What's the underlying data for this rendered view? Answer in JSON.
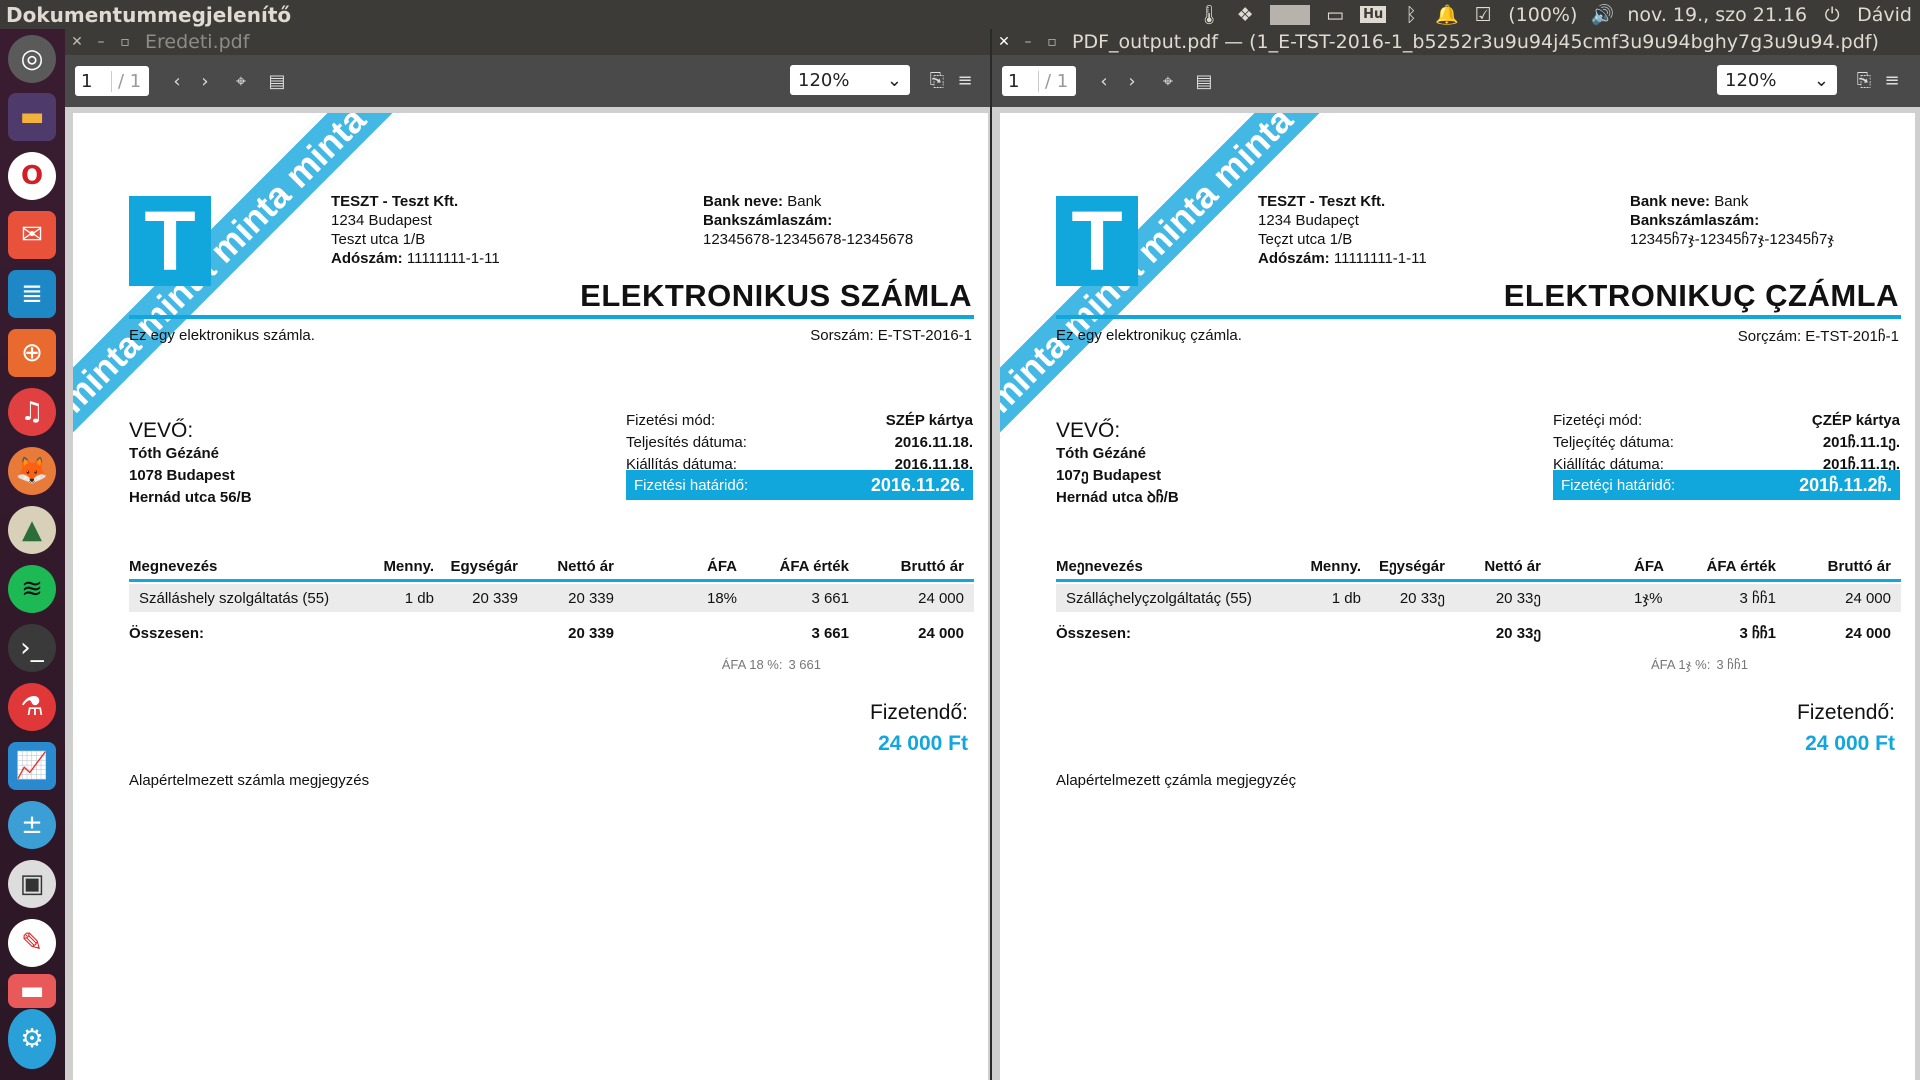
{
  "topbar": {
    "app_title": "Dokumentummegjelenítő",
    "battery": "(100%)",
    "datetime": "nov. 19., szo 21.16",
    "user": "Dávid",
    "keyboard": "Hu"
  },
  "launcher": {
    "items": [
      "ubuntu-dash",
      "files",
      "opera",
      "mail",
      "libreoffice-writer",
      "ubuntu-software",
      "music",
      "gimp",
      "inkscape",
      "spotify",
      "terminal",
      "flask-app",
      "system-monitor",
      "calculator",
      "remote-desktop",
      "signature-app",
      "toggle-app",
      "settings"
    ]
  },
  "left": {
    "window_title": "Eredeti.pdf",
    "page_current": "1",
    "page_total": "/ 1",
    "zoom": "120%",
    "invoice": {
      "logo_letter": "T",
      "issuer_lines": [
        "TESZT - Teszt Kft.",
        "1234 Budapest",
        "Teszt utca 1/B"
      ],
      "tax_label": "Adószám:",
      "tax_value": "11111111-1-11",
      "bank_name_label": "Bank neve:",
      "bank_name_value": "Bank",
      "bank_account_label": "Bankszámlaszám:",
      "bank_account_value": "12345678-12345678-12345678",
      "title": "ELEKTRONIKUS SZÁMLA",
      "subtitle": "Ez egy elektronikus számla.",
      "serial": "Sorszám: E-TST-2016-1",
      "buyer_heading": "VEVŐ:",
      "buyer_lines": [
        "Tóth Gézáné",
        "1078 Budapest",
        "Hernád utca 56/B"
      ],
      "pay_rows": [
        {
          "label": "Fizetési mód:",
          "value": "SZÉP kártya"
        },
        {
          "label": "Teljesítés dátuma:",
          "value": "2016.11.18."
        },
        {
          "label": "Kiállítás dátuma:",
          "value": "2016.11.18."
        }
      ],
      "due_label": "Fizetési határidő:",
      "due_value": "2016.11.26.",
      "headers": [
        "Megnevezés",
        "Menny.",
        "Egységár",
        "Nettó ár",
        "ÁFA",
        "ÁFA érték",
        "Bruttó ár"
      ],
      "row": [
        "Szálláshely  szolgáltatás (55)",
        "1 db",
        "20 339",
        "20 339",
        "18%",
        "3 661",
        "24 000"
      ],
      "sum_label": "Összesen:",
      "sum_net": "20 339",
      "sum_vat": "3 661",
      "sum_gross": "24 000",
      "vat_note_label": "ÁFA 18 %:",
      "vat_note_value": "3 661",
      "payable_label": "Fizetendő:",
      "payable_value": "24 000 Ft",
      "note": "Alapértelmezett számla megjegyzés",
      "stamp": "minta minta minta minta"
    }
  },
  "right": {
    "window_title": "PDF_output.pdf — (1_E-TST-2016-1_b5252r3u9u94j45cmf3u9u94bghy7g3u9u94.pdf)",
    "page_current": "1",
    "page_total": "/ 1",
    "zoom": "120%",
    "invoice": {
      "logo_letter": "T",
      "issuer_lines": [
        "TESZT - Teszt Kft.",
        "1234 Budapeçt",
        "Teçzt utca 1/B"
      ],
      "tax_label": "Adószám:",
      "tax_value": "11111111-1-11",
      "bank_name_label": "Bank neve:",
      "bank_name_value": "Bank",
      "bank_account_label": "Bankszámlaszám:",
      "bank_account_value": "12345ჩ7ჯ-12345ჩ7ჯ-12345ჩ7ჯ",
      "title": "ELEKTRONIKUÇ ÇZÁMLA",
      "subtitle": "Ez egy elektronikuç çzámla.",
      "serial": "Sorçzám: E-TST-201ჩ-1",
      "buyer_heading": "VEVŐ:",
      "buyer_lines": [
        "Tóth Gézáné",
        "107ე Budapest",
        "Hernád utca ꝺჩ/B"
      ],
      "pay_rows": [
        {
          "label": "Fizetéçi mód:",
          "value": "ÇZÉP kártya"
        },
        {
          "label": "Teljeçítéç dátuma:",
          "value": "201ჩ.11.1ე."
        },
        {
          "label": "Kiállítáç dátuma:",
          "value": "201ჩ.11.1ე."
        }
      ],
      "due_label": "Fizetéçi határidő:",
      "due_value": "201ჩ.11.2ჩ.",
      "headers": [
        "Meეnevezés",
        "Menny.",
        "Eეységár",
        "Nettó ár",
        "ÁFA",
        "ÁFA érték",
        "Bruttó ár"
      ],
      "row": [
        "Szálláçhelyçzolgáltatáç (55)",
        "1 db",
        "20 33ე",
        "20 33ე",
        "1ჯ%",
        "3 ჩჩ1",
        "24 000"
      ],
      "sum_label": "Összesen:",
      "sum_net": "20 33ე",
      "sum_vat": "3 ჩჩ1",
      "sum_gross": "24 000",
      "vat_note_label": "ÁFA 1ჯ %:",
      "vat_note_value": "3 ჩჩ1",
      "payable_label": "Fizetendő:",
      "payable_value": "24 000 Ft",
      "note": "Alapértelmezett çzámla megjegyzéç",
      "stamp": "minta minta minta minta"
    }
  },
  "colors": {
    "accent": "#12a7dc",
    "panel": "#3c3b37",
    "launcher": "#3a1c30"
  }
}
